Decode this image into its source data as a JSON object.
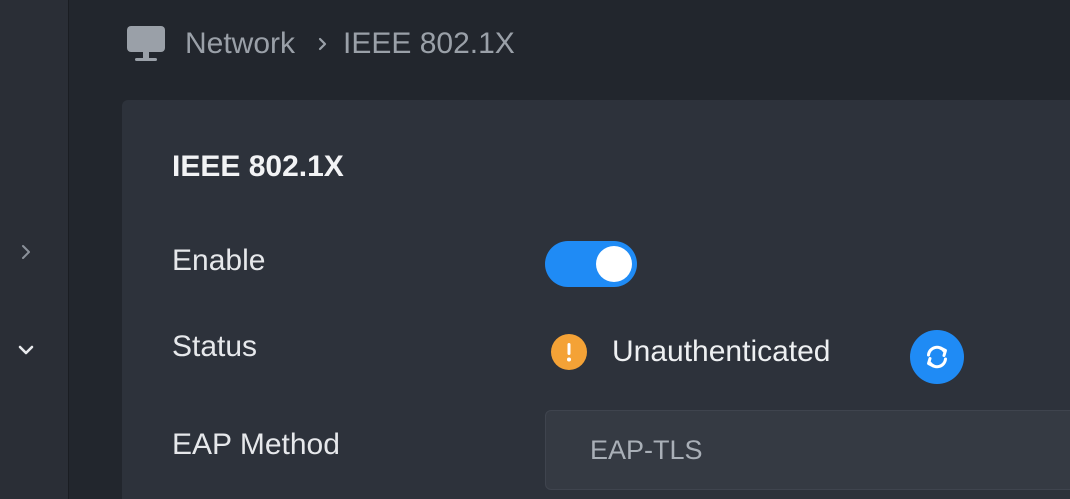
{
  "breadcrumb": {
    "icon": "monitor-icon",
    "parent": "Network",
    "separator_icon": "chevron-right-icon",
    "current": "IEEE 802.1X"
  },
  "sidebar": {
    "icons": [
      "chevron-right-icon",
      "chevron-down-icon"
    ]
  },
  "panel": {
    "title": "IEEE 802.1X",
    "enable": {
      "label": "Enable",
      "value": "on"
    },
    "status": {
      "label": "Status",
      "icon": "warning-icon",
      "value": "Unauthenticated",
      "refresh_icon": "refresh-icon"
    },
    "eap_method": {
      "label": "EAP Method",
      "value": "EAP-TLS"
    }
  },
  "colors": {
    "accent": "#1f8bf5",
    "warning": "#f4a236",
    "background": "#22262d",
    "panel": "#2d323b"
  }
}
